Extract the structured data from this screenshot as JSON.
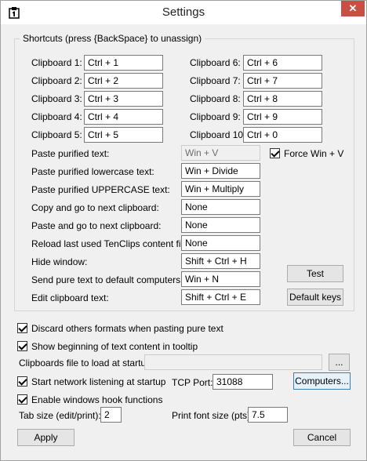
{
  "window": {
    "title": "Settings",
    "close_glyph": "✕"
  },
  "shortcuts": {
    "legend": "Shortcuts (press {BackSpace} to unassign)",
    "left": [
      {
        "label": "Clipboard 1:",
        "value": "Ctrl + 1"
      },
      {
        "label": "Clipboard 2:",
        "value": "Ctrl + 2"
      },
      {
        "label": "Clipboard 3:",
        "value": "Ctrl + 3"
      },
      {
        "label": "Clipboard 4:",
        "value": "Ctrl + 4"
      },
      {
        "label": "Clipboard 5:",
        "value": "Ctrl + 5"
      }
    ],
    "right": [
      {
        "label": "Clipboard 6:",
        "value": "Ctrl + 6"
      },
      {
        "label": "Clipboard 7:",
        "value": "Ctrl + 7"
      },
      {
        "label": "Clipboard 8:",
        "value": "Ctrl + 8"
      },
      {
        "label": "Clipboard 9:",
        "value": "Ctrl + 9"
      },
      {
        "label": "Clipboard 10:",
        "value": "Ctrl + 0"
      }
    ],
    "actions": [
      {
        "label": "Paste purified text:",
        "value": "Win + V"
      },
      {
        "label": "Paste purified lowercase text:",
        "value": "Win + Divide"
      },
      {
        "label": "Paste purified UPPERCASE text:",
        "value": "Win + Multiply"
      },
      {
        "label": "Copy and go to next clipboard:",
        "value": "None"
      },
      {
        "label": "Paste and go to next clipboard:",
        "value": "None"
      },
      {
        "label": "Reload last used TenClips content file:",
        "value": "None"
      },
      {
        "label": "Hide window:",
        "value": "Shift + Ctrl + H"
      },
      {
        "label": "Send pure text to default computers:",
        "value": "Win + N"
      },
      {
        "label": "Edit clipboard text:",
        "value": "Shift + Ctrl + E"
      }
    ],
    "force_win_v": {
      "label": "Force Win + V",
      "checked": true
    },
    "test_button": "Test",
    "default_keys_button": "Default keys"
  },
  "options": {
    "discard_formats": {
      "label": "Discard others formats when pasting pure text",
      "checked": true
    },
    "show_beginning": {
      "label": "Show beginning of text content in tooltip",
      "checked": true
    },
    "clipboards_file_label": "Clipboards file to load at startup:",
    "clipboards_file_value": "",
    "browse_button": "...",
    "network_listening": {
      "label": "Start network listening at startup",
      "checked": true
    },
    "tcp_port_label": "TCP Port:",
    "tcp_port_value": "31088",
    "computers_button": "Computers...",
    "windows_hook": {
      "label": "Enable windows hook functions",
      "checked": true
    },
    "tab_size_label": "Tab size (edit/print):",
    "tab_size_value": "2",
    "print_font_label": "Print font size (pts):",
    "print_font_value": "7.5"
  },
  "footer": {
    "apply": "Apply",
    "cancel": "Cancel"
  }
}
